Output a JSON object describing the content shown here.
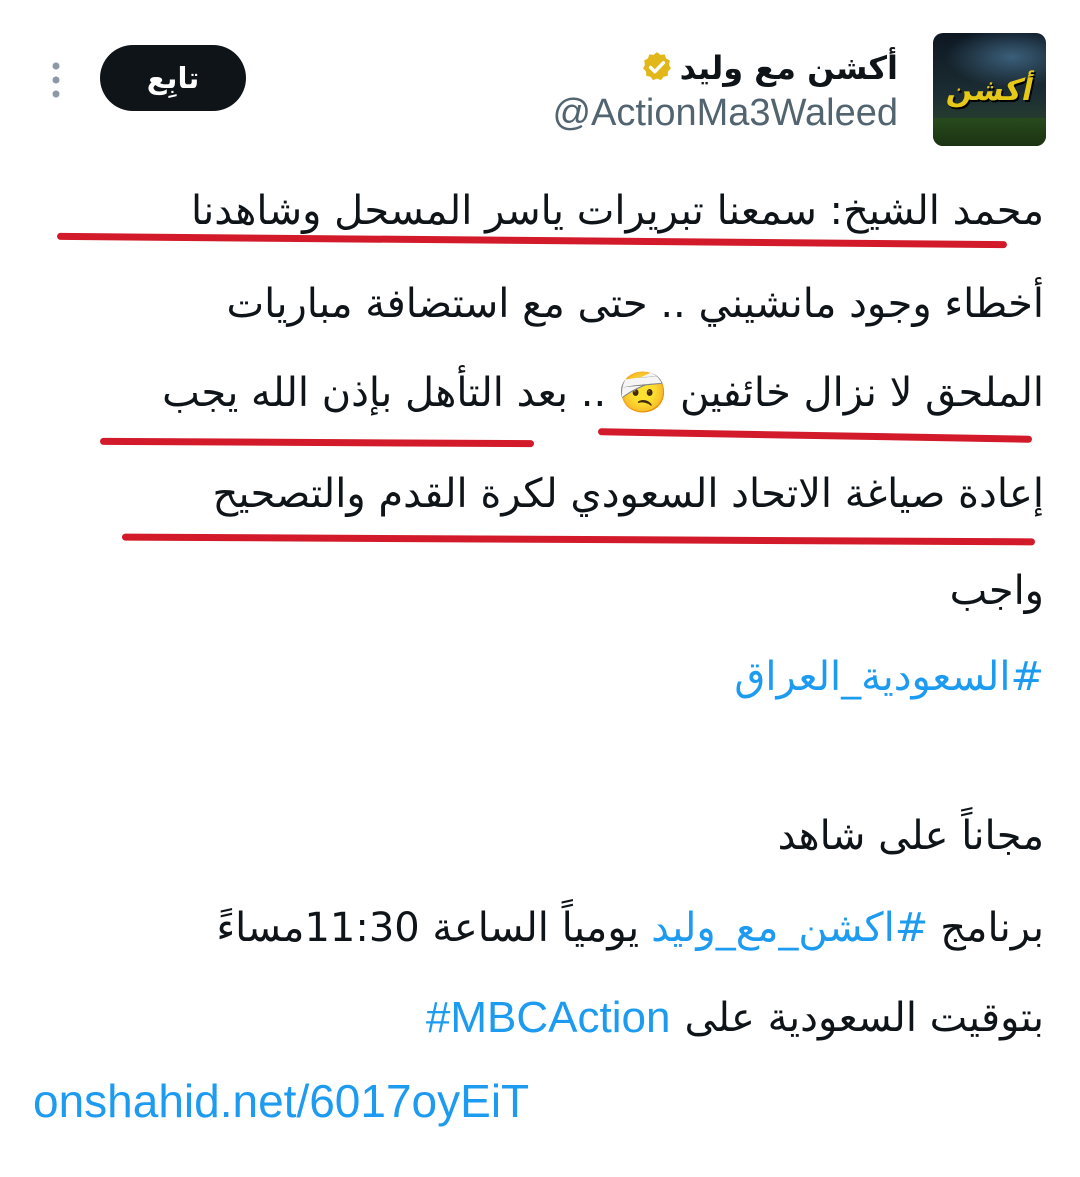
{
  "tweet": {
    "display_name": "أكشن مع وليد",
    "handle": "@ActionMa3Waleed",
    "follow_label": "تابِع",
    "avatar_text": "أكشن",
    "lines": {
      "l1": "محمد الشيخ: سمعنا تبريرات ياسر المسحل وشاهدنا",
      "l2": "أخطاء وجود مانشيني .. حتى مع استضافة مباريات",
      "l3a": "الملحق لا نزال خائفين",
      "l3b": ".. بعد التأهل بإذن الله يجب",
      "l4": "إعادة صياغة الاتحاد السعودي لكرة القدم والتصحيح",
      "l5": "واجب",
      "hashtag1": "#السعودية_العراق",
      "l6": "مجاناً على شاهد",
      "l7a": "برنامج",
      "hashtag2": "#اكشن_مع_وليد",
      "l7b": "يومياً الساعة 11:30مساءً",
      "l8": "بتوقيت السعودية على",
      "hashtag3": "#MBCAction",
      "url": "onshahid.net/6017oyEiT"
    },
    "emoji": "🤕"
  },
  "colors": {
    "link": "#1d9bf0",
    "verified": "#e2b719",
    "underline": "#d21a2a",
    "follow_bg": "#0f1419"
  },
  "icons": [
    "verified-badge-icon",
    "more-options-icon",
    "head-bandage-emoji"
  ]
}
